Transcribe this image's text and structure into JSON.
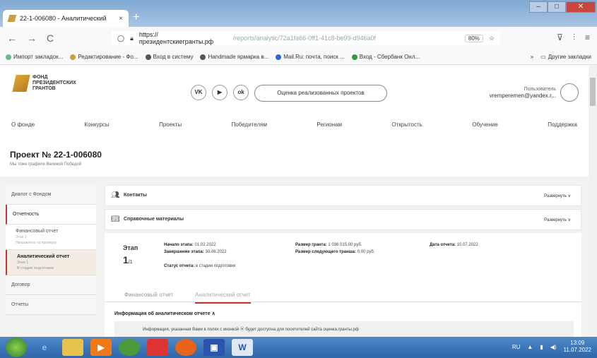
{
  "browser": {
    "tab_title": "22-1-006080 - Аналитический",
    "tab_close": "×",
    "new_tab": "+",
    "url_host": "https://президентскиегранты.рф",
    "url_path": "/reports/analytic/72a1fa66-0ff1-41c8-be99-d946a0f",
    "zoom": "80%",
    "nav_back": "←",
    "nav_forward": "→",
    "nav_reload": "C"
  },
  "bookmarks": [
    "Импорт закладок...",
    "Редактирование - Фо...",
    "Вход в систему",
    "Handmade ярмарка в...",
    "Mail.Ru: почта, поиск ...",
    "Вход - Сбербанк Онл...",
    "»",
    "Другие закладки"
  ],
  "site": {
    "logo_text": [
      "ФОНД",
      "ПРЕЗИДЕНТСКИХ",
      "ГРАНТОВ"
    ],
    "socials": [
      "VK",
      "▶",
      "ok"
    ],
    "rating_button": "Оценка реализованных проектов",
    "user_label": "Пользователь",
    "user_email": "vremperemen@yandex.r..."
  },
  "main_nav": [
    "О фонде",
    "Конкурсы",
    "Проекты",
    "Победителям",
    "Регионам",
    "Открытость",
    "Обучение",
    "Поддержка"
  ],
  "project": {
    "title": "Проект № 22-1-006080",
    "subtitle": "Мы тоже графили Великой Победой"
  },
  "sidebar": {
    "items": [
      {
        "label": "Диалог с Фондом"
      },
      {
        "label": "Отчетность"
      }
    ],
    "subitems": [
      {
        "label": "Финансовый отчет",
        "line1": "Этап 1",
        "line2": "Направлено на проверку"
      },
      {
        "label": "Аналитический отчет",
        "line1": "Этап 1",
        "line2": "В стадии подготовки"
      }
    ],
    "tail": [
      {
        "label": "Договор"
      },
      {
        "label": "Отчеты"
      }
    ]
  },
  "cards": {
    "contacts": "Контакты",
    "materials": "Справочные материалы",
    "expand": "Развернуть ∨"
  },
  "stage": {
    "label": "Этап",
    "number": "1",
    "of": "/1",
    "start_label": "Начало этапа:",
    "start": "01.02.2022",
    "end_label": "Завершение этапа:",
    "end": "30.06.2022",
    "grant_label": "Размер гранта:",
    "grant": "1 036 015,00 руб.",
    "next_label": "Размер следующего транша:",
    "next": "0,00 руб.",
    "report_label": "Дата отчета:",
    "report": "10.07.2022",
    "status_label": "Статус отчета:",
    "status": "в стадии подготовки",
    "tab_fin": "Финансовый отчет",
    "tab_an": "Аналитический отчет",
    "info_heading": "Информация об аналитическом отчете",
    "info_chevron": "∧",
    "info_text": "Информация, указанная Вами в полях с иконкой ⓦ будет доступна для посетителей сайта оценка.гранты.рф"
  },
  "taskbar": {
    "lang": "RU",
    "time": "13:09",
    "date": "11.07.2022"
  }
}
